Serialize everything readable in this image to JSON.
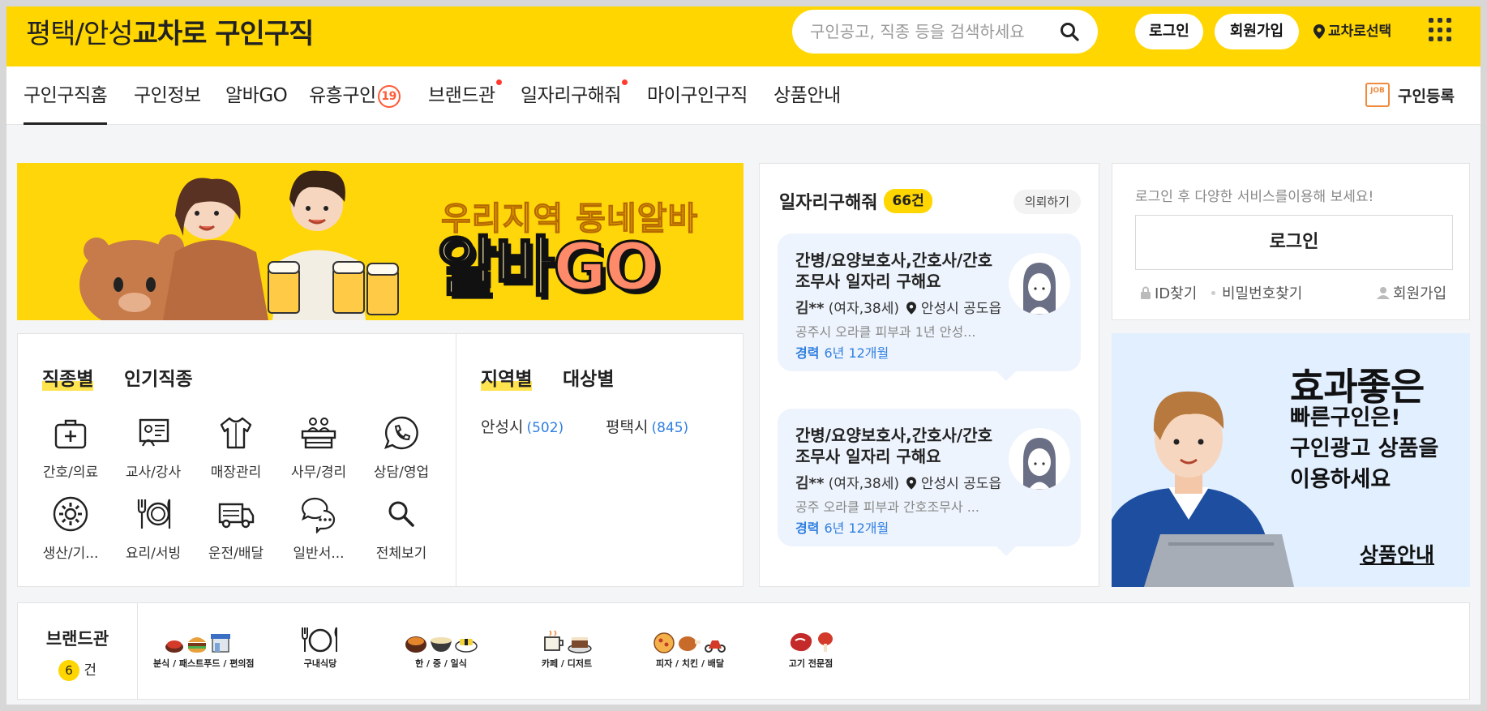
{
  "header": {
    "logo_region": "평택/안성",
    "logo_brand": "교차로 구인구직",
    "search_placeholder": "구인공고, 직종 등을 검색하세요",
    "login_label": "로그인",
    "join_label": "회원가입",
    "area_label": "교차로선택"
  },
  "nav": {
    "items": [
      "구인구직홈",
      "구인정보",
      "알바GO",
      "유흥구인",
      "브랜드관",
      "일자리구해줘",
      "마이구인구직",
      "상품안내"
    ],
    "age_badge": "19",
    "post_job_label": "구인등록",
    "job_icon_text": "JOB"
  },
  "banner": {
    "subtitle": "우리지역 동네알바",
    "title_part1": "알바",
    "title_part2": "GO"
  },
  "categories": {
    "tab_job": "직종별",
    "tab_popular": "인기직종",
    "tab_region": "지역별",
    "tab_target": "대상별",
    "items": [
      "간호/의료",
      "교사/강사",
      "매장관리",
      "사무/경리",
      "상담/영업",
      "생산/기...",
      "요리/서빙",
      "운전/배달",
      "일반서...",
      "전체보기"
    ],
    "regions": [
      {
        "name": "안성시",
        "count": "(502)"
      },
      {
        "name": "평택시",
        "count": "(845)"
      }
    ]
  },
  "requests": {
    "title": "일자리구해줘",
    "count_badge": "66건",
    "request_button": "의뢰하기",
    "cards": [
      {
        "title": "간병/요양보호사,간호사/간호조무사 일자리 구해요",
        "name": "김**",
        "info": "(여자,38세)",
        "location": "안성시 공도읍",
        "desc": "공주시 오라클 피부과 1년 안성...",
        "exp_label": "경력",
        "exp_value": "6년 12개월"
      },
      {
        "title": "간병/요양보호사,간호사/간호조무사 일자리 구해요",
        "name": "김**",
        "info": "(여자,38세)",
        "location": "안성시 공도읍",
        "desc": "공주 오라클 피부과 간호조무사 ...",
        "exp_label": "경력",
        "exp_value": "6년 12개월"
      }
    ]
  },
  "login_panel": {
    "message": "로그인 후 다양한 서비스를이용해 보세요!",
    "login_button": "로그인",
    "find_id": "ID찾기",
    "find_pw": "비밀번호찾기",
    "join": "회원가입"
  },
  "ad": {
    "headline": "효과좋은",
    "line1": "빠른구인은!",
    "line2": "구인광고 상품을",
    "line3": "이용하세요",
    "link": "상품안내"
  },
  "brand": {
    "label": "브랜드관",
    "count": "6",
    "count_unit": "건",
    "logos": [
      "분식 / 패스트푸드 / 편의점",
      "구내식당",
      "한 / 중 / 일식",
      "카페 / 디저트",
      "피자 / 치킨 / 배달",
      "고기 전문점"
    ]
  },
  "colors": {
    "brand_yellow": "#ffd600",
    "link_blue": "#2f7fe0",
    "alert_red": "#ff3b2f"
  }
}
